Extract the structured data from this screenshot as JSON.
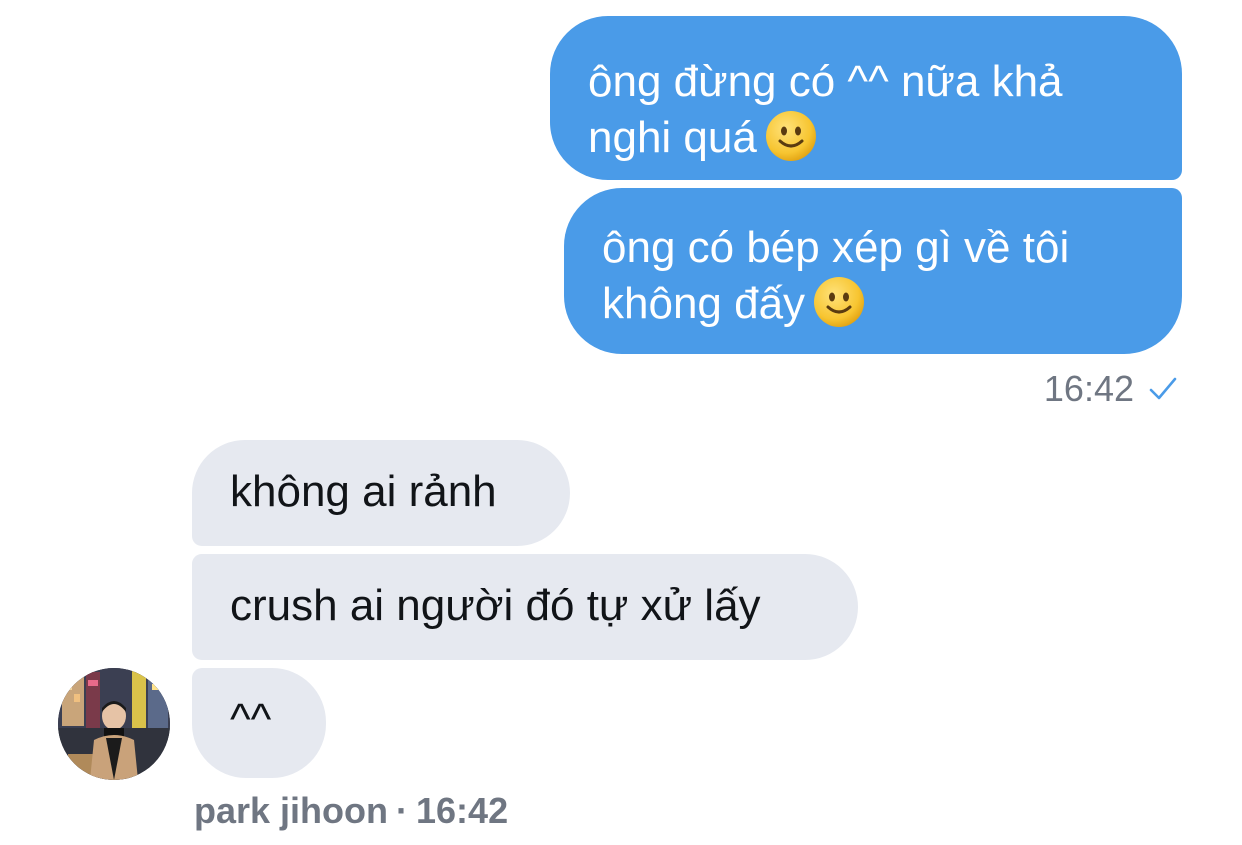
{
  "conversation": {
    "sent_messages": [
      {
        "text": "ông đừng có ^^ nữa khả",
        "text_line2": "nghi quá",
        "emoji": "slightly-smiling-face"
      },
      {
        "text": "ông có bép xép gì về tôi",
        "text_line2": "không đấy",
        "emoji": "slightly-smiling-face"
      }
    ],
    "sent_meta": {
      "time": "16:42",
      "status_icon": "checkmark-icon"
    },
    "received_messages": [
      {
        "text": "không ai rảnh"
      },
      {
        "text": "crush ai người đó tự xử lấy"
      },
      {
        "text": "^^"
      }
    ],
    "received_meta": {
      "sender": "park jihoon",
      "separator": "·",
      "time": "16:42"
    }
  },
  "colors": {
    "sent_bubble": "#4a9be8",
    "received_bubble": "#e6e9f0",
    "meta_text": "#6f7682",
    "check": "#4a9be8"
  }
}
